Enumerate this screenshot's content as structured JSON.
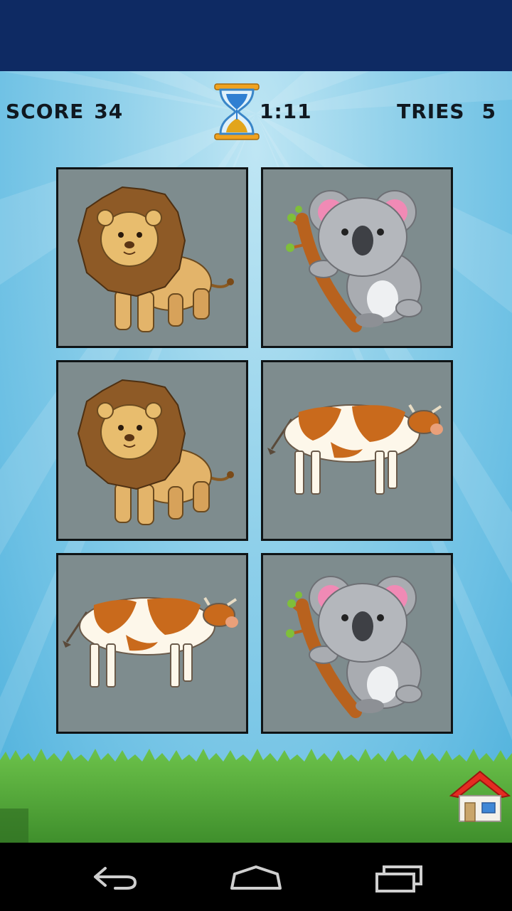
{
  "hud": {
    "score_label": "SCORE",
    "score_value": "34",
    "timer_value": "1:11",
    "tries_label": "TRIES",
    "tries_value": "5",
    "timer_icon": "hourglass-icon"
  },
  "board": {
    "rows": 3,
    "cols": 2,
    "cards": [
      {
        "animal": "lion",
        "icon": "lion-icon",
        "face_up": true
      },
      {
        "animal": "koala",
        "icon": "koala-icon",
        "face_up": true
      },
      {
        "animal": "lion",
        "icon": "lion-icon",
        "face_up": true
      },
      {
        "animal": "cow",
        "icon": "cow-icon",
        "face_up": true
      },
      {
        "animal": "cow",
        "icon": "cow-icon",
        "face_up": true
      },
      {
        "animal": "koala",
        "icon": "koala-icon",
        "face_up": true
      }
    ]
  },
  "footer": {
    "home_icon": "house-icon"
  },
  "nav_bar": {
    "icons": [
      "back-arrow-icon",
      "home-outline-icon",
      "recent-apps-icon"
    ]
  },
  "colors": {
    "status_bar": "#0e2a63",
    "sky": "#7cc8e8",
    "card_bg": "#7e8c8e",
    "card_border": "#0f1416",
    "grass": "#4fa63a"
  }
}
